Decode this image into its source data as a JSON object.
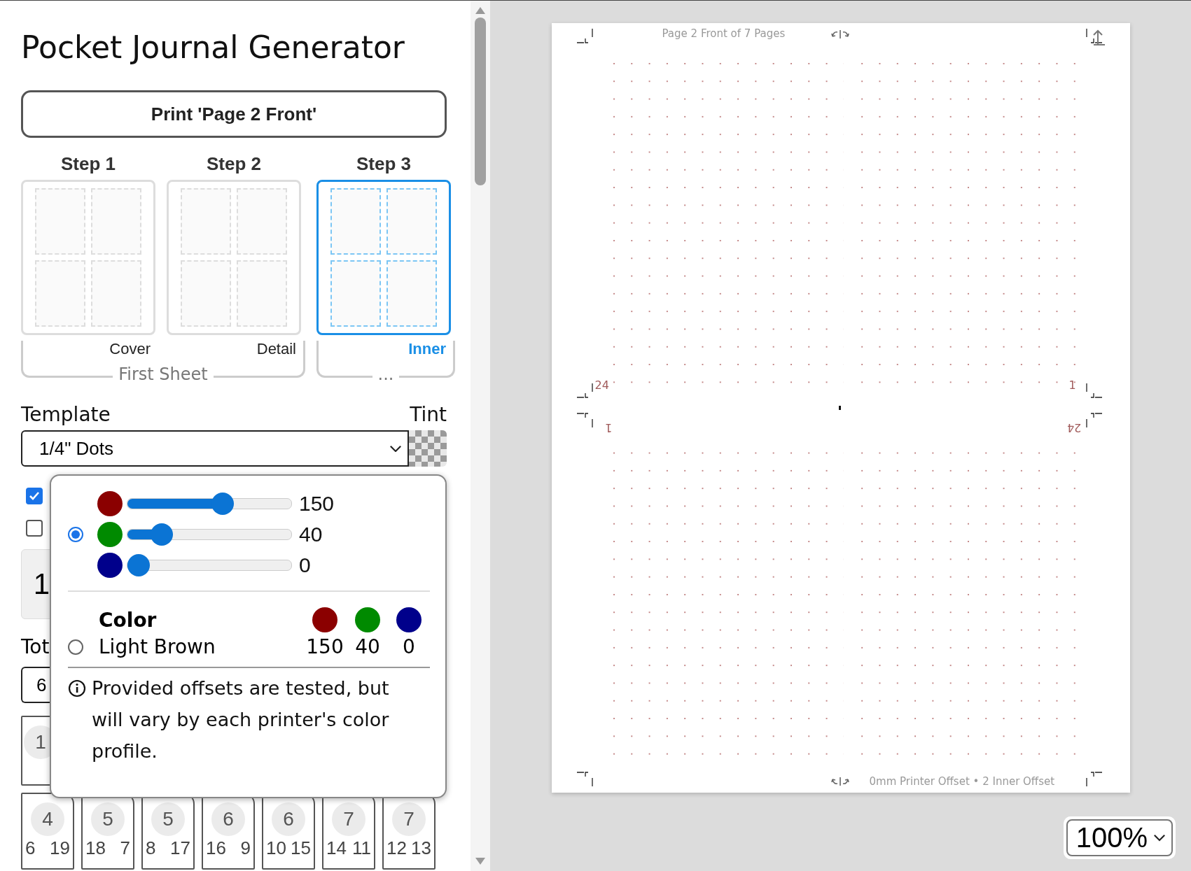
{
  "title": "Pocket Journal Generator",
  "print_button": "Print 'Page 2 Front'",
  "step_groups": [
    {
      "label": "First Sheet",
      "steps": [
        {
          "heading": "Step 1",
          "label": "Cover",
          "selected": false
        },
        {
          "heading": "Step 2",
          "label": "Detail",
          "selected": false
        }
      ]
    },
    {
      "label": "...",
      "steps": [
        {
          "heading": "Step 3",
          "label": "Inner",
          "selected": true
        }
      ]
    }
  ],
  "template": {
    "label": "Template",
    "value": "1/4\" Dots"
  },
  "tint": {
    "label": "Tint"
  },
  "checkboxes": [
    {
      "checked": true
    },
    {
      "checked": false
    }
  ],
  "count_box": {
    "value": "1"
  },
  "total": {
    "label": "Tot",
    "value": "6"
  },
  "sheet_rows": [
    [
      {
        "number": "1"
      }
    ],
    [
      {
        "number": "4",
        "pages": [
          "6",
          "19"
        ]
      },
      {
        "number": "5",
        "pages": [
          "18",
          "7"
        ]
      },
      {
        "number": "5",
        "pages": [
          "8",
          "17"
        ]
      },
      {
        "number": "6",
        "pages": [
          "16",
          "9"
        ]
      },
      {
        "number": "6",
        "pages": [
          "10",
          "15"
        ]
      },
      {
        "number": "7",
        "pages": [
          "14",
          "11"
        ]
      },
      {
        "number": "7",
        "pages": [
          "12",
          "13"
        ]
      }
    ]
  ],
  "tint_popup": {
    "custom": {
      "selected": true,
      "channels": [
        {
          "color": "#8b0000",
          "level": 0.59,
          "reading": "150"
        },
        {
          "color": "#008a00",
          "level": 0.16,
          "reading": "40"
        },
        {
          "color": "#00008b",
          "level": 0,
          "reading": "0"
        }
      ]
    },
    "preset": {
      "header": "Color",
      "name": "Light Brown",
      "selected": false,
      "swatches": [
        {
          "color": "#8b0000",
          "value": "150"
        },
        {
          "color": "#008a00",
          "value": "40"
        },
        {
          "color": "#00008b",
          "value": "0"
        }
      ]
    },
    "note": "Provided offsets are tested, but will vary by each printer's color profile."
  },
  "page": {
    "header": "Page 2 Front of 7 Pages",
    "footer": "0mm Printer Offset • 2 Inner Offset",
    "page_numbers": [
      {
        "text": "24",
        "flipped": false
      },
      {
        "text": "1",
        "flipped": false
      },
      {
        "text": "1",
        "flipped": true
      },
      {
        "text": "24",
        "flipped": true
      }
    ]
  },
  "zoom": {
    "value": "100%"
  }
}
